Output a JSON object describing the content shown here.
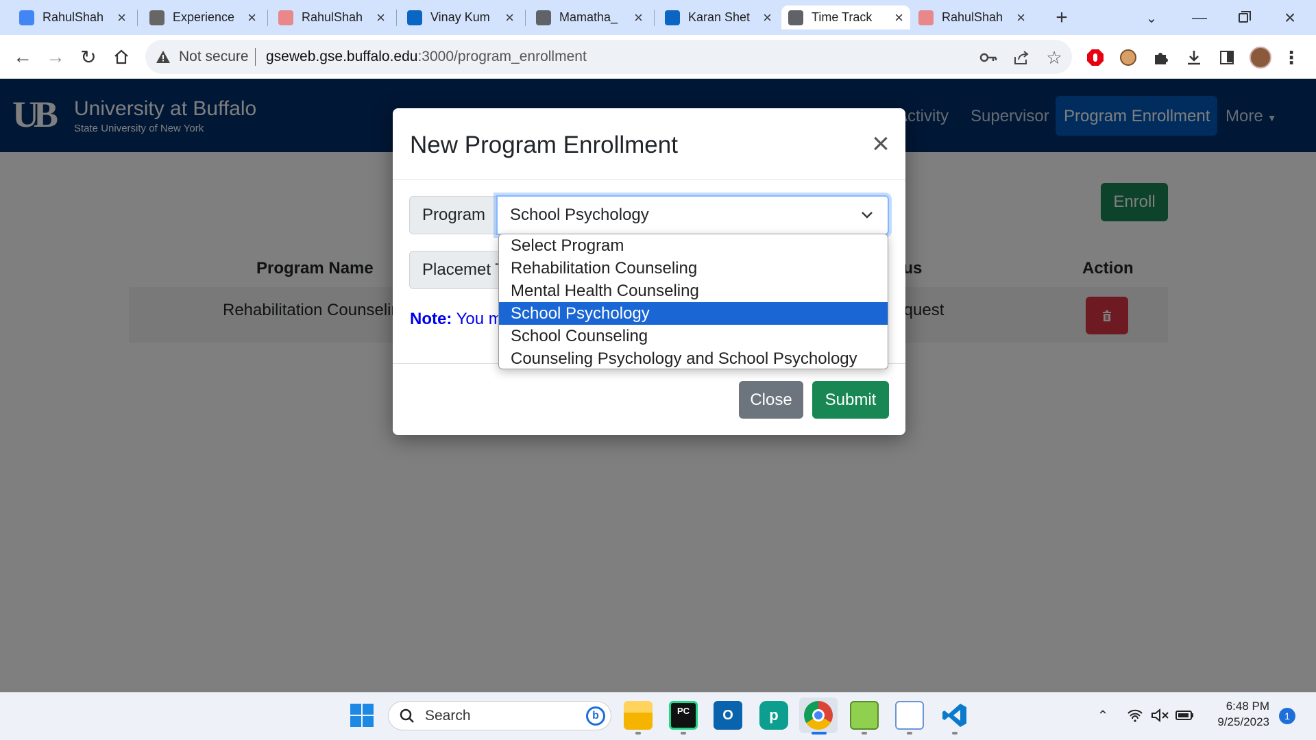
{
  "browser": {
    "tabs": [
      {
        "title": "RahulShah",
        "icon": "docs-icon",
        "color": "#4285f4"
      },
      {
        "title": "Experience",
        "icon": "openai-icon",
        "color": "#666666"
      },
      {
        "title": "RahulShah",
        "icon": "image-icon",
        "color": "#e8888b"
      },
      {
        "title": "Vinay Kum",
        "icon": "linkedin-icon",
        "color": "#0a66c2"
      },
      {
        "title": "Mamatha_",
        "icon": "globe-icon",
        "color": "#5f6368"
      },
      {
        "title": "Karan Shet",
        "icon": "linkedin-icon",
        "color": "#0a66c2"
      },
      {
        "title": "Time Track",
        "icon": "globe-icon",
        "color": "#5f6368",
        "active": true
      },
      {
        "title": "RahulShah",
        "icon": "image-icon",
        "color": "#e8888b"
      }
    ],
    "security_label": "Not secure",
    "url_host": "gseweb.gse.buffalo.edu",
    "url_path": ":3000/program_enrollment"
  },
  "site": {
    "logo_mark": "UB",
    "logo_title": "University at Buffalo",
    "logo_subtitle": "State University of New York",
    "nav": [
      "Activity",
      "Supervisor",
      "Program Enrollment",
      "More"
    ],
    "active_nav": "Program Enrollment",
    "enroll_label": "Enroll",
    "table_headers": [
      "Program Name",
      "Status",
      "Action"
    ],
    "row": {
      "program": "Rehabilitation Counseling",
      "status": "Request"
    }
  },
  "modal": {
    "title": "New Program Enrollment",
    "program_label": "Program",
    "program_value": "School Psychology",
    "placement_label": "Placemet T",
    "note_strong": "Note:",
    "note_text": "You m",
    "close_label": "Close",
    "submit_label": "Submit",
    "options": [
      "Select Program",
      "Rehabilitation Counseling",
      "Mental Health Counseling",
      "School Psychology",
      "School Counseling",
      "Counseling Psychology and School Psychology"
    ],
    "selected_index": 3
  },
  "taskbar": {
    "search_placeholder": "Search",
    "time": "6:48 PM",
    "date": "9/25/2023",
    "notification_count": "1"
  },
  "colors": {
    "ub_blue": "#002f6c",
    "ub_active": "#005bbb",
    "enroll_green": "#198754",
    "delete_red": "#dc3545",
    "close_gray": "#6c757d",
    "dropdown_highlight": "#1a66d5"
  }
}
